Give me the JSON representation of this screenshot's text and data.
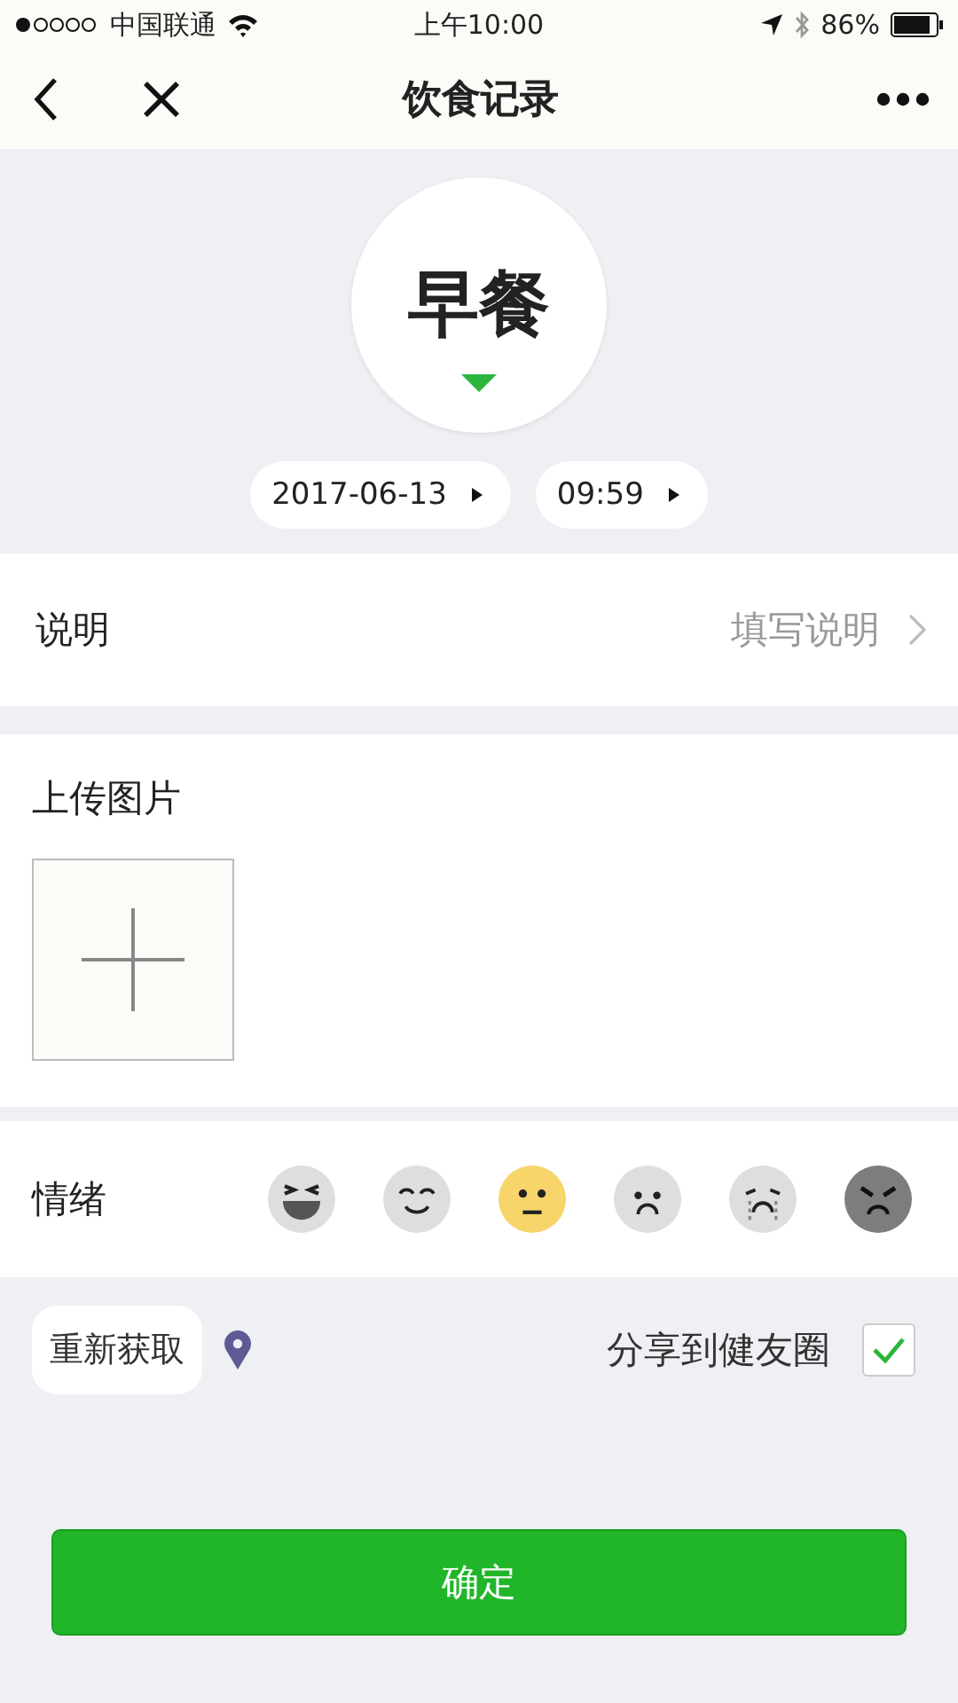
{
  "status_bar": {
    "carrier": "中国联通",
    "time": "上午10:00",
    "battery": "86%"
  },
  "nav": {
    "title": "饮食记录"
  },
  "meal": {
    "name": "早餐",
    "date": "2017-06-13",
    "time": "09:59"
  },
  "note": {
    "label": "说明",
    "placeholder": "填写说明"
  },
  "upload": {
    "label": "上传图片"
  },
  "mood": {
    "label": "情绪",
    "faces": [
      {
        "kind": "laugh",
        "selected": false
      },
      {
        "kind": "smile",
        "selected": false
      },
      {
        "kind": "neutral",
        "selected": true
      },
      {
        "kind": "worried",
        "selected": false
      },
      {
        "kind": "cry",
        "selected": false
      },
      {
        "kind": "angry",
        "selected": false
      }
    ]
  },
  "location": {
    "button": "重新获取"
  },
  "share": {
    "label": "分享到健友圈",
    "checked": true
  },
  "confirm": {
    "label": "确定"
  }
}
